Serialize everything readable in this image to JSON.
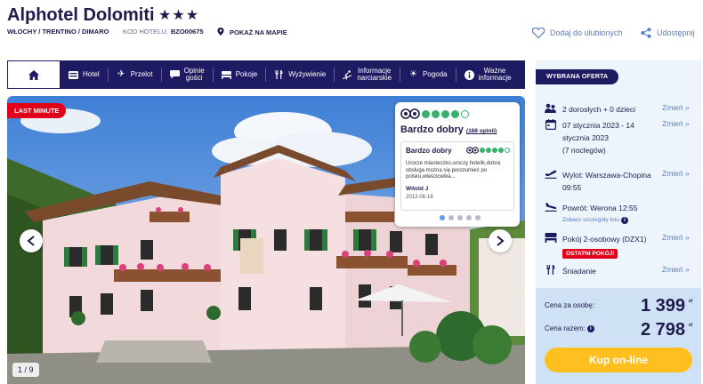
{
  "hotel": {
    "name": "Alphotel Dolomiti",
    "stars": "★★★",
    "breadcrumb": "WŁOCHY / TRENTINO / DIMARO",
    "code_label": "KOD HOTELU:",
    "code": "BZO00675",
    "map_link": "POKAŻ NA MAPIE",
    "favorite": "Dodaj do ulubionych",
    "share": "Udostępnij"
  },
  "nav": {
    "home_icon": "home-icon",
    "items": [
      {
        "icon": "hotel-icon",
        "label": "Hotel"
      },
      {
        "icon": "plane-icon",
        "label": "Przelot"
      },
      {
        "icon": "chat-icon",
        "label": "Opinie gości",
        "line1": "Opinie",
        "line2": "gości"
      },
      {
        "icon": "bed-icon",
        "label": "Pokoje"
      },
      {
        "icon": "cutlery-icon",
        "label": "Wyżywienie"
      },
      {
        "icon": "ski-icon",
        "label": "Informacje narciarskie",
        "line1": "Informacje",
        "line2": "narciarskie"
      },
      {
        "icon": "sun-icon",
        "label": "Pogoda"
      },
      {
        "icon": "info-icon",
        "label": "Ważne informacje",
        "line1": "Ważne",
        "line2": "informacje"
      }
    ]
  },
  "gallery": {
    "badge": "LAST MINUTE",
    "counter": "1 / 9",
    "current": 1,
    "total": 9
  },
  "review": {
    "rating": 4,
    "rating_max": 5,
    "title": "Bardzo dobry",
    "count": "(168 opinii)",
    "item": {
      "title": "Bardzo dobry",
      "rating": 4,
      "text": "Urocze miasteczko,uroczy hotelik,dobra obsługa można się porozumieć po polsku,właścicielka...",
      "author": "Witold J",
      "date": "2013-06-16"
    },
    "pages": 5,
    "active_page": 1
  },
  "offer": {
    "header": "WYBRANA OFERTA",
    "change_label": "Zmień »",
    "guests": "2 dorosłych + 0 dzieci",
    "dates_line1": "07 stycznia 2023 - 14",
    "dates_line2": "stycznia 2023",
    "nights": "(7 noclegów)",
    "departure_line1": "Wylot: Warszawa-Chopina",
    "departure_line2": "09:55",
    "return": "Powrót: Werona 12:55",
    "flight_details": "Zobacz szczegóły lotu",
    "room": "Pokój 2-osobowy (DZX1)",
    "last_room": "OSTATNI POKÓJ!",
    "board": "Śniadanie",
    "price_per_person_label": "Cena za osobę:",
    "price_per_person": "1 399",
    "price_total_label": "Cena razem:",
    "price_total": "2 798",
    "currency": "zł",
    "buy": "Kup on-line"
  },
  "colors": {
    "navy": "#1f1b62",
    "accent_blue": "#5b7fc0",
    "red": "#e2001a",
    "green": "#34b26b",
    "yellow": "#ffbf1f",
    "sidebar_bg": "#eef4fb",
    "pricebox_bg": "#cfe1f4"
  }
}
